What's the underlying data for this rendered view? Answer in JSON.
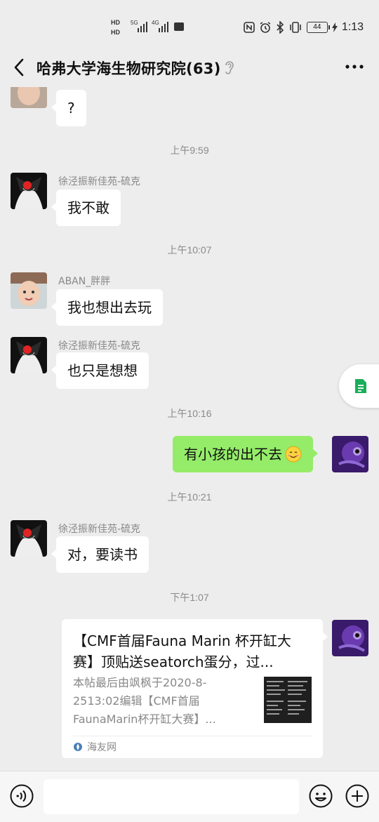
{
  "status_bar": {
    "time": "1:13",
    "battery": "44",
    "network_1": "5G",
    "network_2": "4G"
  },
  "header": {
    "title": "哈弗大学海生物研究院(63)",
    "back_icon": "chevron-left-icon",
    "more_icon": "more-dots-icon"
  },
  "messages": [
    {
      "type": "bubble",
      "side": "left",
      "text": "?"
    },
    {
      "type": "time",
      "text": "上午9:59"
    },
    {
      "type": "bubble",
      "side": "left",
      "sender": "徐泾振新佳苑-硫克",
      "text": "我不敢"
    },
    {
      "type": "time",
      "text": "上午10:07"
    },
    {
      "type": "bubble",
      "side": "left",
      "sender": "ABAN_胖胖",
      "text": "我也想出去玩"
    },
    {
      "type": "bubble",
      "side": "left",
      "sender": "徐泾振新佳苑-硫克",
      "text": "也只是想想"
    },
    {
      "type": "time",
      "text": "上午10:16"
    },
    {
      "type": "bubble",
      "side": "right",
      "text": "有小孩的出不去"
    },
    {
      "type": "time",
      "text": "上午10:21"
    },
    {
      "type": "bubble",
      "side": "left",
      "sender": "徐泾振新佳苑-硫克",
      "text": "对，要读书"
    },
    {
      "type": "time",
      "text": "下午1:07"
    }
  ],
  "link_card": {
    "title": "【CMF首届Fauna Marin 杯开缸大赛】顶贴送seatorch蛋分，过...",
    "description": "本帖最后由飒枫于2020-8-2513:02编辑【CMF首届FaunaMarin杯开缸大赛】...",
    "source": "海友网"
  },
  "input_bar": {
    "placeholder": "",
    "voice_icon": "voice-icon",
    "emoji_icon": "emoji-icon",
    "plus_icon": "plus-icon"
  },
  "colors": {
    "background": "#ededed",
    "bubble_self": "#95ec69",
    "bubble_other": "#ffffff"
  }
}
